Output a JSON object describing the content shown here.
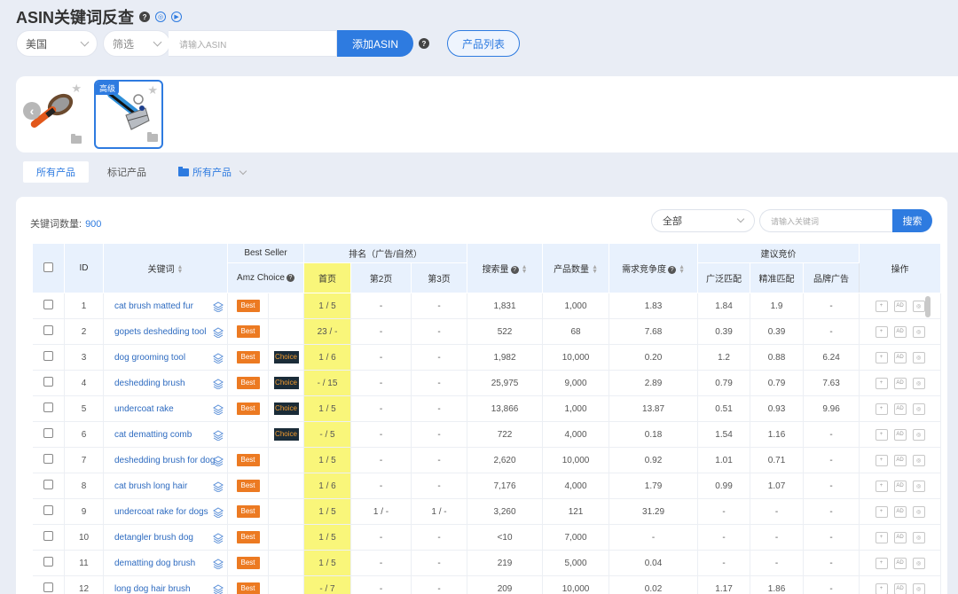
{
  "header": {
    "title": "ASIN关键词反查"
  },
  "search": {
    "country": "美国",
    "filter": "筛选",
    "asin_placeholder": "请输入ASIN",
    "add_label": "添加ASIN",
    "product_list_label": "产品列表"
  },
  "gallery": {
    "advanced_badge": "高级"
  },
  "tabs": [
    {
      "label": "所有产品"
    },
    {
      "label": "标记产品"
    },
    {
      "label": "所有产品"
    }
  ],
  "panel": {
    "keyword_count_label": "关键词数量:",
    "keyword_count": "900",
    "filter_value": "全部",
    "keyword_placeholder": "请输入关键词",
    "search_label": "搜索"
  },
  "table": {
    "headers": {
      "id": "ID",
      "keyword": "关键词",
      "best_seller": "Best Seller",
      "amz_choice": "Amz Choice",
      "rank_group": "排名（广告/自然）",
      "page1": "首页",
      "page2": "第2页",
      "page3": "第3页",
      "search_volume": "搜索量",
      "product_count": "产品数量",
      "competition": "需求竞争度",
      "bid_group": "建议竞价",
      "broad": "广泛匹配",
      "exact": "精准匹配",
      "brand": "品牌广告",
      "ops": "操作"
    },
    "best_label": "Best",
    "choice_label": "Choice",
    "rows": [
      {
        "id": "1",
        "keyword": "cat brush matted fur",
        "p1": "1 / 5",
        "p2": "-",
        "p3": "-",
        "volume": "1,831",
        "products": "1,000",
        "competition": "1.83",
        "broad": "1.84",
        "exact": "1.9",
        "brand": "-",
        "best": true,
        "choice": false
      },
      {
        "id": "2",
        "keyword": "gopets deshedding tool",
        "p1": "23 / -",
        "p2": "-",
        "p3": "-",
        "volume": "522",
        "products": "68",
        "competition": "7.68",
        "broad": "0.39",
        "exact": "0.39",
        "brand": "-",
        "best": true,
        "choice": false
      },
      {
        "id": "3",
        "keyword": "dog grooming tool",
        "p1": "1 / 6",
        "p2": "-",
        "p3": "-",
        "volume": "1,982",
        "products": "10,000",
        "competition": "0.20",
        "broad": "1.2",
        "exact": "0.88",
        "brand": "6.24",
        "best": true,
        "choice": true
      },
      {
        "id": "4",
        "keyword": "deshedding brush",
        "p1": "- / 15",
        "p2": "-",
        "p3": "-",
        "volume": "25,975",
        "products": "9,000",
        "competition": "2.89",
        "broad": "0.79",
        "exact": "0.79",
        "brand": "7.63",
        "best": true,
        "choice": true
      },
      {
        "id": "5",
        "keyword": "undercoat rake",
        "p1": "1 / 5",
        "p2": "-",
        "p3": "-",
        "volume": "13,866",
        "products": "1,000",
        "competition": "13.87",
        "broad": "0.51",
        "exact": "0.93",
        "brand": "9.96",
        "best": true,
        "choice": true
      },
      {
        "id": "6",
        "keyword": "cat dematting comb",
        "p1": "- / 5",
        "p2": "-",
        "p3": "-",
        "volume": "722",
        "products": "4,000",
        "competition": "0.18",
        "broad": "1.54",
        "exact": "1.16",
        "brand": "-",
        "best": false,
        "choice": true
      },
      {
        "id": "7",
        "keyword": "deshedding brush for dog",
        "p1": "1 / 5",
        "p2": "-",
        "p3": "-",
        "volume": "2,620",
        "products": "10,000",
        "competition": "0.92",
        "broad": "1.01",
        "exact": "0.71",
        "brand": "-",
        "best": true,
        "choice": false
      },
      {
        "id": "8",
        "keyword": "cat brush long hair",
        "p1": "1 / 6",
        "p2": "-",
        "p3": "-",
        "volume": "7,176",
        "products": "4,000",
        "competition": "1.79",
        "broad": "0.99",
        "exact": "1.07",
        "brand": "-",
        "best": true,
        "choice": false
      },
      {
        "id": "9",
        "keyword": "undercoat rake for dogs",
        "p1": "1 / 5",
        "p2": "1 / -",
        "p3": "1 / -",
        "volume": "3,260",
        "products": "121",
        "competition": "31.29",
        "broad": "-",
        "exact": "-",
        "brand": "-",
        "best": true,
        "choice": false
      },
      {
        "id": "10",
        "keyword": "detangler brush dog",
        "p1": "1 / 5",
        "p2": "-",
        "p3": "-",
        "volume": "<10",
        "products": "7,000",
        "competition": "-",
        "broad": "-",
        "exact": "-",
        "brand": "-",
        "best": true,
        "choice": false
      },
      {
        "id": "11",
        "keyword": "dematting dog brush",
        "p1": "1 / 5",
        "p2": "-",
        "p3": "-",
        "volume": "219",
        "products": "5,000",
        "competition": "0.04",
        "broad": "-",
        "exact": "-",
        "brand": "-",
        "best": true,
        "choice": false
      },
      {
        "id": "12",
        "keyword": "long dog hair brush",
        "p1": "- / 7",
        "p2": "-",
        "p3": "-",
        "volume": "209",
        "products": "10,000",
        "competition": "0.02",
        "broad": "1.17",
        "exact": "1.86",
        "brand": "-",
        "best": true,
        "choice": false
      }
    ]
  }
}
